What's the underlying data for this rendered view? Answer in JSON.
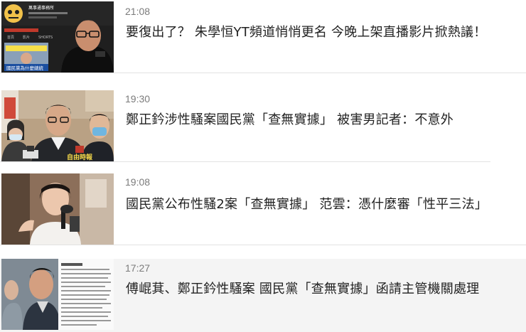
{
  "news": [
    {
      "time": "21:08",
      "title": "要復出了？ 朱學恒YT頻道悄悄更名 今晚上架直播影片掀熱議！",
      "thumb_texts": {
        "channel_name": "萬事通事務所",
        "tab_home": "首頁",
        "tab_videos": "影片",
        "tab_shorts": "SHORTS",
        "caption": "國民黨為什麼總統"
      }
    },
    {
      "time": "19:30",
      "title": "鄭正鈐涉性騷案國民黨「查無實據」 被害男記者：不意外",
      "thumb_texts": {
        "logo": "自由時報"
      }
    },
    {
      "time": "19:08",
      "title": "國民黨公布性騷2案「查無實據」 范雲：憑什麼審「性平三法」",
      "thumb_texts": {}
    },
    {
      "time": "17:27",
      "title": "傅崐萁、鄭正鈐性騷案 國民黨「查無實據」函請主管機關處理",
      "thumb_texts": {}
    }
  ],
  "colors": {
    "time": "#7b7b7b",
    "title": "#222222",
    "separator": "#e2e2e2",
    "highlight_row": "#f4f4f4"
  }
}
